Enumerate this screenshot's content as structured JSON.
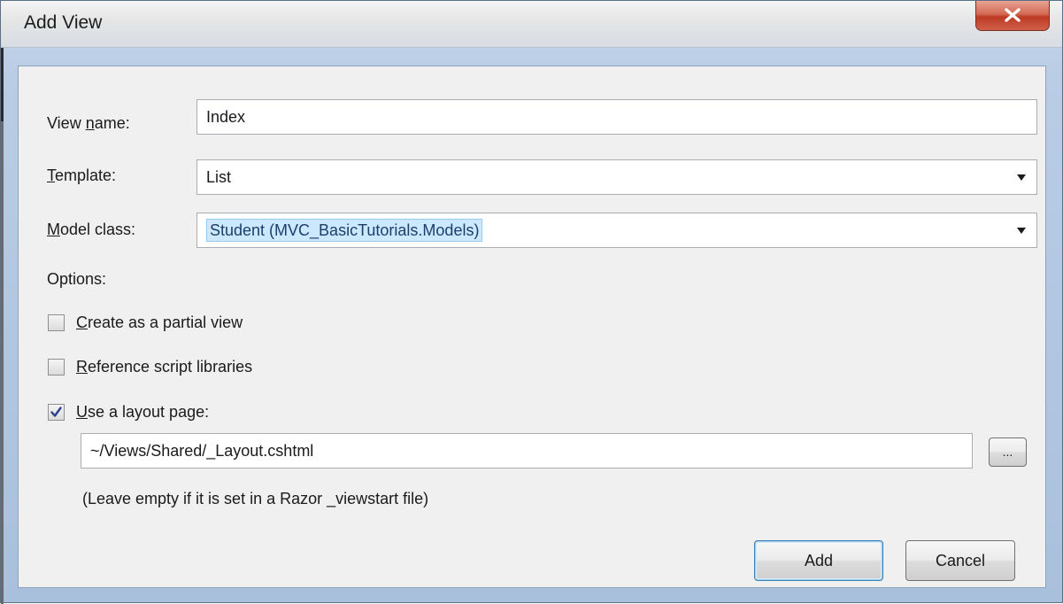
{
  "dialog": {
    "title": "Add View",
    "view_name": {
      "label_pre": "View ",
      "label_key": "n",
      "label_post": "ame:",
      "value": "Index"
    },
    "template": {
      "label_pre": "",
      "label_key": "T",
      "label_post": "emplate:",
      "value": "List"
    },
    "model_class": {
      "label_pre": "",
      "label_key": "M",
      "label_post": "odel class:",
      "value": "Student (MVC_BasicTutorials.Models)"
    },
    "options_label": "Options:",
    "options": [
      {
        "key": "C",
        "rest": "reate as a partial view",
        "checked": false
      },
      {
        "key": "R",
        "rest": "eference script libraries",
        "checked": false
      },
      {
        "key": "U",
        "rest": "se a layout page:",
        "checked": true
      }
    ],
    "layout_path": "~/Views/Shared/_Layout.cshtml",
    "browse_label": "...",
    "hint": "(Leave empty if it is set in a Razor _viewstart file)",
    "add_label": "Add",
    "cancel_label": "Cancel"
  },
  "colors": {
    "selection": "#cce8ff",
    "close_button": "#c94a33",
    "default_button_border": "#3c7fb1"
  }
}
